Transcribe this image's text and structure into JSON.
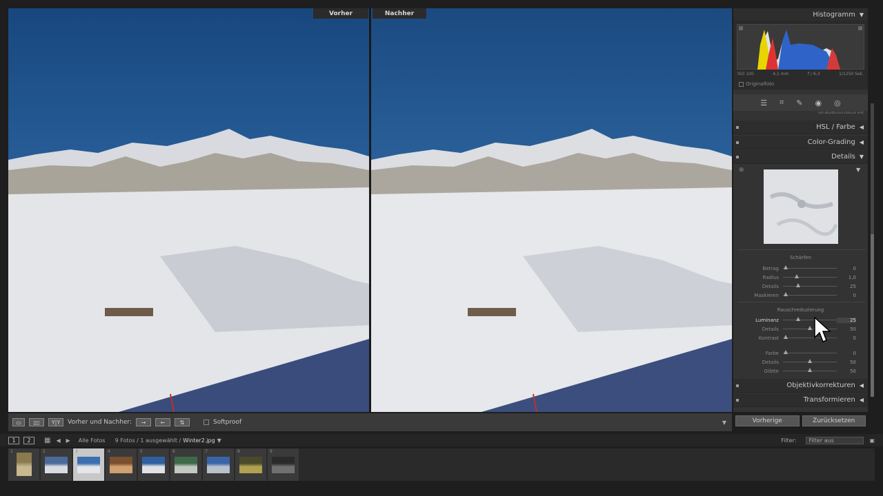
{
  "compare": {
    "before_label": "Vorher",
    "after_label": "Nachher"
  },
  "toolbar": {
    "view_mode_label": "Vorher und Nachher:",
    "softproof_label": "Softproof",
    "btn_single": "▭",
    "btn_split": "▯▯",
    "btn_yy": "Y|Y",
    "btn_copy_right": "→",
    "btn_copy_left": "←",
    "btn_swap": "⇅"
  },
  "histogram": {
    "title": "Histogramm",
    "iso": "ISO 100",
    "focal": "4,1 mm",
    "aperture": "f / 6,3",
    "shutter": "1/1250 Sek.",
    "original_photo_label": "Originalfoto"
  },
  "panels": {
    "hsl": "HSL / Farbe",
    "color_grading": "Color-Grading",
    "details": "Details",
    "lens": "Objektivkorrekturen",
    "transform": "Transformieren",
    "tonecurve_partial": "Gradationskurve"
  },
  "sharpen": {
    "title": "Schärfen",
    "rows": [
      {
        "name": "Betrag",
        "value": "0",
        "pos": 0.05
      },
      {
        "name": "Radius",
        "value": "1,0",
        "pos": 0.25
      },
      {
        "name": "Details",
        "value": "25",
        "pos": 0.28
      },
      {
        "name": "Maskieren",
        "value": "0",
        "pos": 0.05
      }
    ]
  },
  "noise": {
    "title": "Rauschreduzierung",
    "rows": [
      {
        "name": "Luminanz",
        "value": "25",
        "pos": 0.28,
        "active": true
      },
      {
        "name": "Details",
        "value": "50",
        "pos": 0.5
      },
      {
        "name": "Kontrast",
        "value": "0",
        "pos": 0.05
      },
      {
        "name": "Farbe",
        "value": "0",
        "pos": 0.05
      },
      {
        "name": "Details",
        "value": "50",
        "pos": 0.5
      },
      {
        "name": "Glätte",
        "value": "50",
        "pos": 0.5
      }
    ]
  },
  "buttons": {
    "previous": "Vorherige",
    "reset": "Zurücksetzen"
  },
  "nav": {
    "page1": "1",
    "page2": "2",
    "source": "Alle Fotos",
    "count": "9 Fotos / 1 ausgewählt /",
    "filename": "Winter2.jpg",
    "filter_label": "Filter:",
    "filter_value": "Filter aus"
  },
  "filmstrip": {
    "numbers": [
      "1",
      "2",
      "3",
      "4",
      "5",
      "6",
      "7",
      "8",
      "9"
    ]
  },
  "colors": {
    "sky_top": "#1b4f8a",
    "sky_bottom": "#3d7fbf",
    "snow": "#e6e8eb",
    "shadow_blue": "#3a4c7c"
  }
}
